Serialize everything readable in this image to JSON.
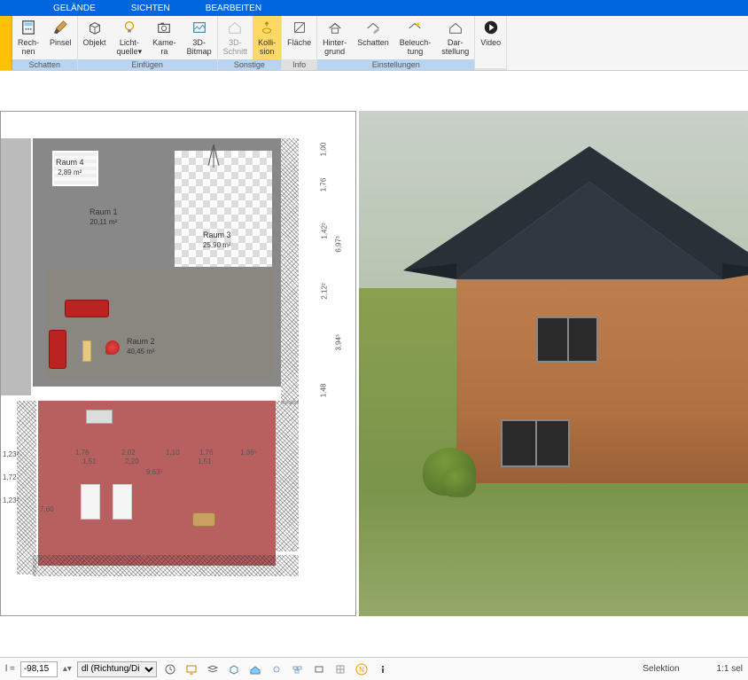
{
  "menubar": {
    "items": [
      "GELÄNDE",
      "SICHTEN",
      "BEARBEITEN"
    ]
  },
  "ribbon": {
    "groups": [
      {
        "label": "Schatten",
        "label_class": "blue",
        "buttons": [
          {
            "name": "rechnen",
            "line1": "Rech-",
            "line2": "nen",
            "icon": "calc"
          },
          {
            "name": "pinsel",
            "line1": "Pinsel",
            "line2": "",
            "icon": "brush"
          }
        ]
      },
      {
        "label": "Einfügen",
        "label_class": "blue",
        "buttons": [
          {
            "name": "objekt",
            "line1": "Objekt",
            "line2": "",
            "icon": "cube"
          },
          {
            "name": "lichtquelle",
            "line1": "Licht-",
            "line2": "quelle▾",
            "icon": "bulb"
          },
          {
            "name": "kamera",
            "line1": "Kame-",
            "line2": "ra",
            "icon": "camera"
          },
          {
            "name": "3d-bitmap",
            "line1": "3D-",
            "line2": "Bitmap",
            "icon": "bitmap"
          }
        ]
      },
      {
        "label": "Sonstige",
        "label_class": "blue",
        "buttons": [
          {
            "name": "3d-schnitt",
            "line1": "3D-",
            "line2": "Schnitt",
            "icon": "cut3d"
          },
          {
            "name": "kollision",
            "line1": "Kolli-",
            "line2": "sion",
            "icon": "collision",
            "active": true
          }
        ]
      },
      {
        "label": "Info",
        "label_class": "",
        "buttons": [
          {
            "name": "flaeche",
            "line1": "Fläche",
            "line2": "",
            "icon": "area"
          }
        ]
      },
      {
        "label": "Einstellungen",
        "label_class": "blue",
        "buttons": [
          {
            "name": "hintergrund",
            "line1": "Hinter-",
            "line2": "grund",
            "icon": "bg"
          },
          {
            "name": "schatten",
            "line1": "Schatten",
            "line2": "",
            "icon": "shadow"
          },
          {
            "name": "beleuchtung",
            "line1": "Beleuch-",
            "line2": "tung",
            "icon": "light"
          },
          {
            "name": "darstellung",
            "line1": "Dar-",
            "line2": "stellung",
            "icon": "display"
          }
        ]
      },
      {
        "label": "",
        "label_class": "",
        "buttons": [
          {
            "name": "video",
            "line1": "Video",
            "line2": "",
            "icon": "video"
          }
        ]
      }
    ]
  },
  "floorplan": {
    "rooms": [
      {
        "name": "Raum 4",
        "area": "2,89 m²"
      },
      {
        "name": "Raum 1",
        "area": "20,11 m²"
      },
      {
        "name": "Raum 3",
        "area": "25,90 m²"
      },
      {
        "name": "Raum 2",
        "area": "40,45 m²"
      }
    ],
    "dimensions_right": [
      "1,00",
      "1,76",
      "1,42²",
      "6,97³",
      "2,12²",
      "3,94³",
      "1,48"
    ],
    "dimensions_bottom": {
      "row1": [
        "1,76",
        "2,02",
        "1,10",
        "1,76",
        "1,36⁵"
      ],
      "row2": [
        "1,51",
        "2,20",
        "1,51"
      ],
      "overall": "9,63⁵"
    },
    "dimensions_left": [
      "1,23²",
      "1,72",
      "1,23²",
      "7,60"
    ]
  },
  "bottom_bar": {
    "eq_label": "l =",
    "input_value": "-98,15",
    "select_value": "dl (Richtung/Di",
    "status_left": "Selektion",
    "status_right": "1:1 sel"
  }
}
